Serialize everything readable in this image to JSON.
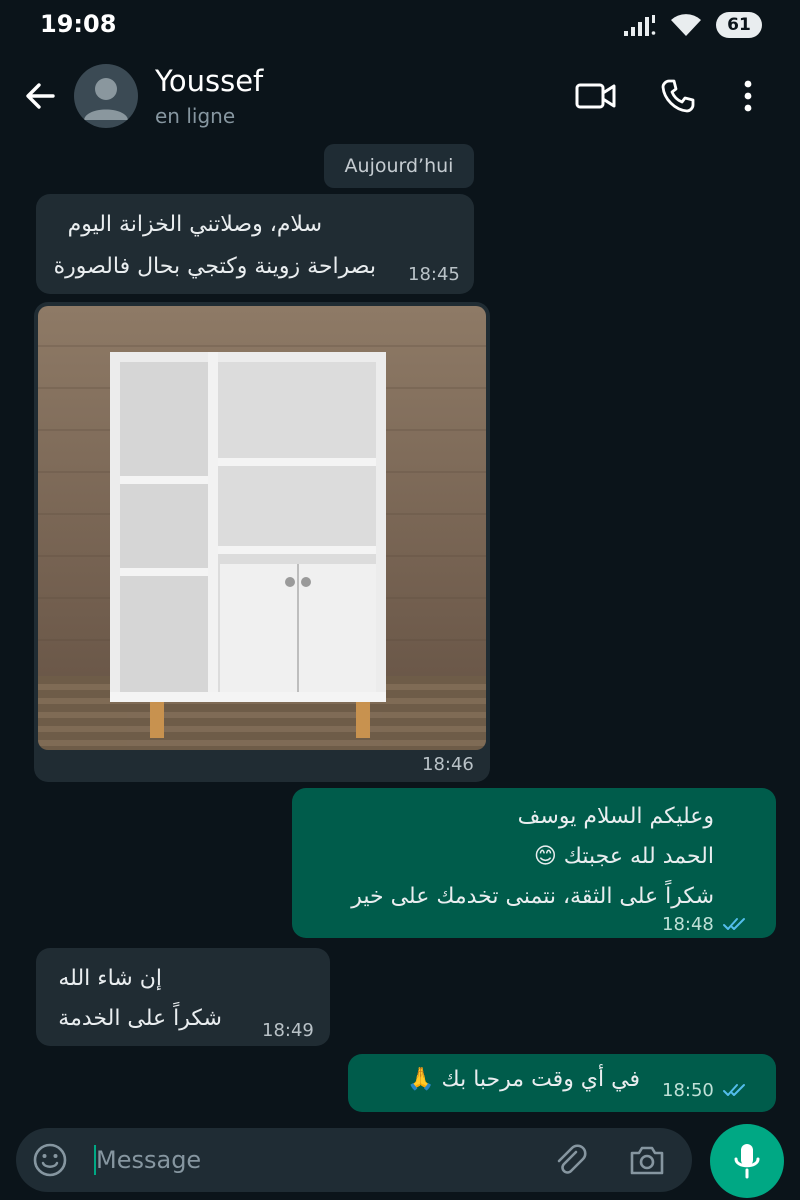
{
  "status_bar": {
    "time": "19:08",
    "battery": "61"
  },
  "header": {
    "contact_name": "Youssef",
    "contact_status": "en ligne"
  },
  "chat": {
    "date_chip": "Aujourd’hui",
    "messages": [
      {
        "direction": "incoming",
        "lines": [
          "سلام، وصلاتني الخزانة  اليوم",
          "بصراحة زوينة وكتجي بحال فالصورة"
        ],
        "time": "18:45"
      },
      {
        "direction": "incoming",
        "type": "image",
        "time": "18:46"
      },
      {
        "direction": "outgoing",
        "lines": [
          "وعليكم السلام يوسف",
          "الحمد لله عجبتك 😊",
          "شكراً على الثقة، نتمنى تخدمك على خير"
        ],
        "time": "18:48",
        "status": "read"
      },
      {
        "direction": "incoming",
        "lines": [
          "إن شاء الله",
          "شكراً على الخدمة"
        ],
        "time": "18:49"
      },
      {
        "direction": "outgoing",
        "lines": [
          "في أي وقت مرحبا بك 🙏"
        ],
        "time": "18:50",
        "status": "read"
      }
    ]
  },
  "input": {
    "placeholder": "Message"
  },
  "colors": {
    "background": "#0b141a",
    "incoming": "#202c33",
    "outgoing": "#005c4b",
    "accent": "#00a884",
    "read_ticks": "#53bdeb"
  },
  "icons": [
    "back-arrow-icon",
    "avatar-icon",
    "video-call-icon",
    "phone-icon",
    "more-vert-icon",
    "emoji-icon",
    "attach-icon",
    "camera-icon",
    "mic-icon",
    "read-ticks-icon",
    "signal-icon",
    "wifi-icon",
    "battery-icon"
  ]
}
